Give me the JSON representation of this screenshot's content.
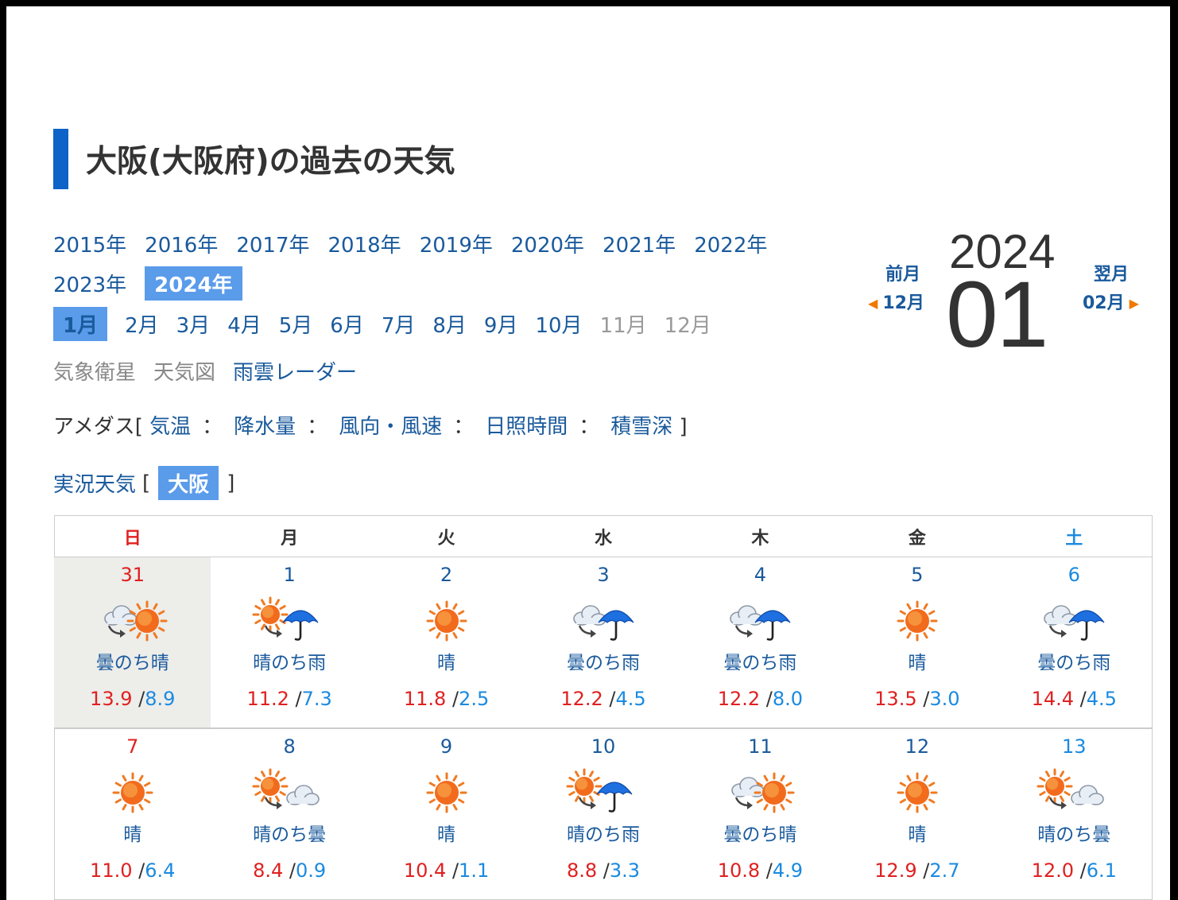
{
  "title": "大阪(大阪府)の過去の天気",
  "years_row1": [
    "2015年",
    "2016年",
    "2017年",
    "2018年",
    "2019年",
    "2020年",
    "2021年",
    "2022年"
  ],
  "years_row2": [
    "2023年"
  ],
  "year_selected": "2024年",
  "months": [
    {
      "label": "1月",
      "state": "selected"
    },
    {
      "label": "2月",
      "state": "link"
    },
    {
      "label": "3月",
      "state": "link"
    },
    {
      "label": "4月",
      "state": "link"
    },
    {
      "label": "5月",
      "state": "link"
    },
    {
      "label": "6月",
      "state": "link"
    },
    {
      "label": "7月",
      "state": "link"
    },
    {
      "label": "8月",
      "state": "link"
    },
    {
      "label": "9月",
      "state": "link"
    },
    {
      "label": "10月",
      "state": "link"
    },
    {
      "label": "11月",
      "state": "disabled"
    },
    {
      "label": "12月",
      "state": "disabled"
    }
  ],
  "misc": {
    "satellite": "気象衛星",
    "weather_map": "天気図",
    "radar": "雨雲レーダー"
  },
  "amedas": {
    "label": "アメダス",
    "open": "[",
    "close": "]",
    "sep": "：",
    "items": [
      "気温",
      "降水量",
      "風向・風速",
      "日照時間",
      "積雪深"
    ]
  },
  "jikkyo": {
    "label": "実況天気",
    "open": "[",
    "close": "]",
    "station": "大阪"
  },
  "nav": {
    "prev_label": "前月",
    "prev_month": "12月",
    "next_label": "翌月",
    "next_month": "02月",
    "year": "2024",
    "month": "01"
  },
  "weekdays": [
    "日",
    "月",
    "火",
    "水",
    "木",
    "金",
    "土"
  ],
  "weeks": [
    [
      {
        "day": "31",
        "icon": "cloudy-then-sunny",
        "weather": "曇のち晴",
        "max": "13.9",
        "min": "8.9",
        "today": true
      },
      {
        "day": "1",
        "icon": "sunny-then-rain",
        "weather": "晴のち雨",
        "max": "11.2",
        "min": "7.3"
      },
      {
        "day": "2",
        "icon": "sunny",
        "weather": "晴",
        "max": "11.8",
        "min": "2.5"
      },
      {
        "day": "3",
        "icon": "cloudy-then-rain",
        "weather": "曇のち雨",
        "max": "12.2",
        "min": "4.5"
      },
      {
        "day": "4",
        "icon": "cloudy-then-rain",
        "weather": "曇のち雨",
        "max": "12.2",
        "min": "8.0"
      },
      {
        "day": "5",
        "icon": "sunny",
        "weather": "晴",
        "max": "13.5",
        "min": "3.0"
      },
      {
        "day": "6",
        "icon": "cloudy-then-rain",
        "weather": "曇のち雨",
        "max": "14.4",
        "min": "4.5"
      }
    ],
    [
      {
        "day": "7",
        "icon": "sunny",
        "weather": "晴",
        "max": "11.0",
        "min": "6.4"
      },
      {
        "day": "8",
        "icon": "sunny-then-cloudy",
        "weather": "晴のち曇",
        "max": "8.4",
        "min": "0.9"
      },
      {
        "day": "9",
        "icon": "sunny",
        "weather": "晴",
        "max": "10.4",
        "min": "1.1"
      },
      {
        "day": "10",
        "icon": "sunny-then-rain",
        "weather": "晴のち雨",
        "max": "8.8",
        "min": "3.3"
      },
      {
        "day": "11",
        "icon": "cloudy-then-sunny",
        "weather": "曇のち晴",
        "max": "10.8",
        "min": "4.9"
      },
      {
        "day": "12",
        "icon": "sunny",
        "weather": "晴",
        "max": "12.9",
        "min": "2.7"
      },
      {
        "day": "13",
        "icon": "sunny-then-cloudy",
        "weather": "晴のち曇",
        "max": "12.0",
        "min": "6.1"
      }
    ]
  ],
  "colors": {
    "link": "#1a5a9c",
    "accent_bar": "#0d63c8",
    "selected_bg": "#5a9bea",
    "sunday": "#e02020",
    "saturday": "#1a8ae0",
    "max_temp": "#e02020",
    "min_temp": "#1a8ae0"
  }
}
